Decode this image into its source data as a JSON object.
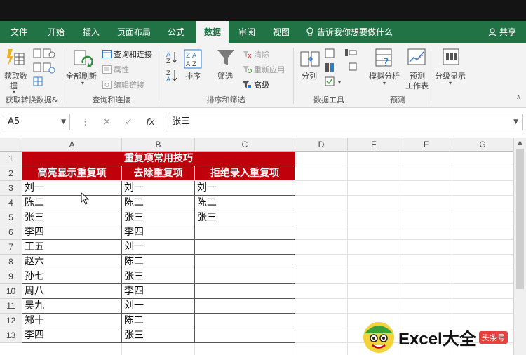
{
  "tabs": [
    "文件",
    "开始",
    "插入",
    "页面布局",
    "公式",
    "数据",
    "审阅",
    "视图"
  ],
  "active_tab": "数据",
  "tell_me": "告诉我你想要做什么",
  "share": "共享",
  "ribbon": {
    "get_data": "获取数",
    "get_data2": "据",
    "refresh_all": "全部刷新",
    "queries_connections": "查询和连接",
    "properties": "属性",
    "edit_links": "编辑链接",
    "sort": "排序",
    "filter": "筛选",
    "clear": "清除",
    "reapply": "重新应用",
    "advanced": "高级",
    "split": "分列",
    "what_if": "模拟分析",
    "forecast": "预测",
    "forecast2": "工作表",
    "outline": "分级显示",
    "groups": {
      "get_transform": "获取转换数据&",
      "queries": "查询和连接",
      "sort_filter": "排序和筛选",
      "data_tools": "数据工具",
      "forecast": "预测"
    }
  },
  "formula_bar": {
    "name_box": "A5",
    "fx": "fx",
    "value": "张三"
  },
  "columns": [
    "A",
    "B",
    "C",
    "D",
    "E",
    "F",
    "G"
  ],
  "rows": [
    "1",
    "2",
    "3",
    "4",
    "5",
    "6",
    "7",
    "8",
    "9",
    "10",
    "11",
    "12",
    "13"
  ],
  "sheet": {
    "title": "重复项常用技巧",
    "headers": [
      "高亮显示重复项",
      "去除重复项",
      "拒绝录入重复项"
    ],
    "col_a": [
      "刘一",
      "陈二",
      "张三",
      "李四",
      "王五",
      "赵六",
      "孙七",
      "周八",
      "吴九",
      "郑十",
      "李四"
    ],
    "col_b": [
      "刘一",
      "陈二",
      "张三",
      "李四",
      "刘一",
      "陈二",
      "张三",
      "李四",
      "刘一",
      "陈二",
      "张三"
    ],
    "col_c": [
      "刘一",
      "陈二",
      "张三",
      "",
      "",
      "",
      "",
      "",
      "",
      "",
      ""
    ]
  },
  "watermark": {
    "text": "Excel大全",
    "badge": "头条号"
  },
  "colors": {
    "ribbon_green": "#217346",
    "header_red": "#c0000b"
  }
}
